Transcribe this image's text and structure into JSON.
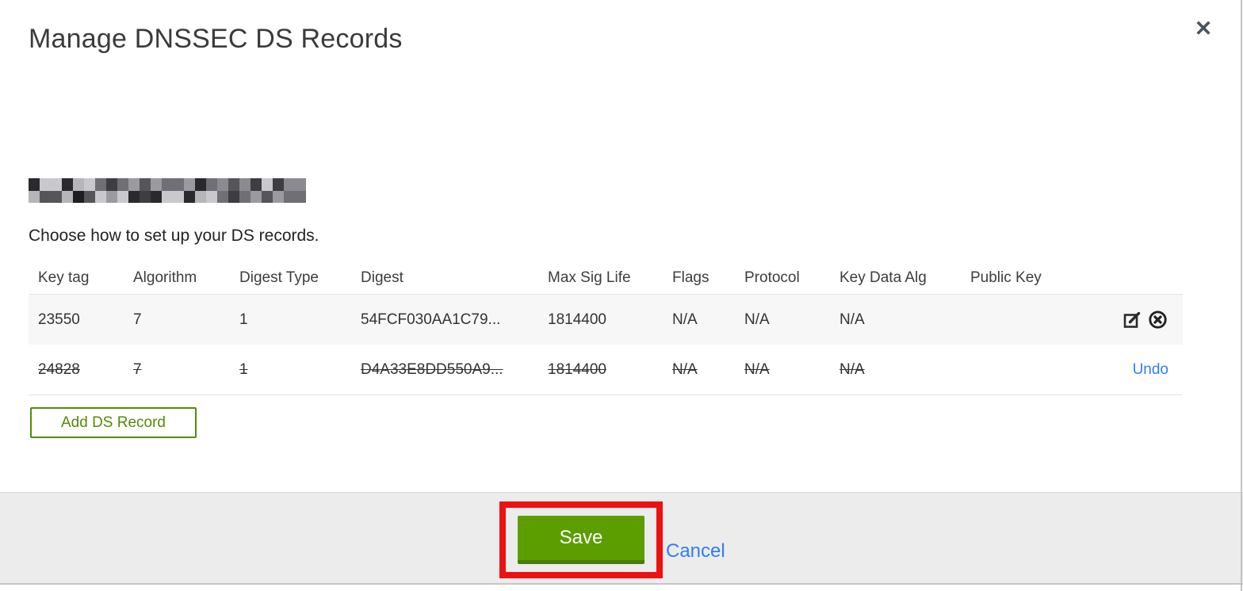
{
  "modal": {
    "title": "Manage DNSSEC DS Records",
    "close_glyph": "✕",
    "instruction": "Choose how to set up your DS records."
  },
  "table": {
    "headers": [
      "Key tag",
      "Algorithm",
      "Digest Type",
      "Digest",
      "Max Sig Life",
      "Flags",
      "Protocol",
      "Key Data Alg",
      "Public Key"
    ],
    "rows": [
      {
        "cells": [
          "23550",
          "7",
          "1",
          "54FCF030AA1C79...",
          "1814400",
          "N/A",
          "N/A",
          "N/A",
          ""
        ],
        "deleted": false
      },
      {
        "cells": [
          "24828",
          "7",
          "1",
          "D4A33E8DD550A9...",
          "1814400",
          "N/A",
          "N/A",
          "N/A",
          ""
        ],
        "deleted": true,
        "undo_label": "Undo"
      }
    ]
  },
  "buttons": {
    "add_ds_record": "Add DS Record",
    "save": "Save",
    "cancel": "Cancel"
  },
  "colors": {
    "save-green": "#5c9e00",
    "save-green-dark": "#4a7d08",
    "outline-green": "#538b03",
    "link-blue": "#2f7df6",
    "annotation-red": "#ee1111",
    "footer-gray": "#ececec"
  }
}
